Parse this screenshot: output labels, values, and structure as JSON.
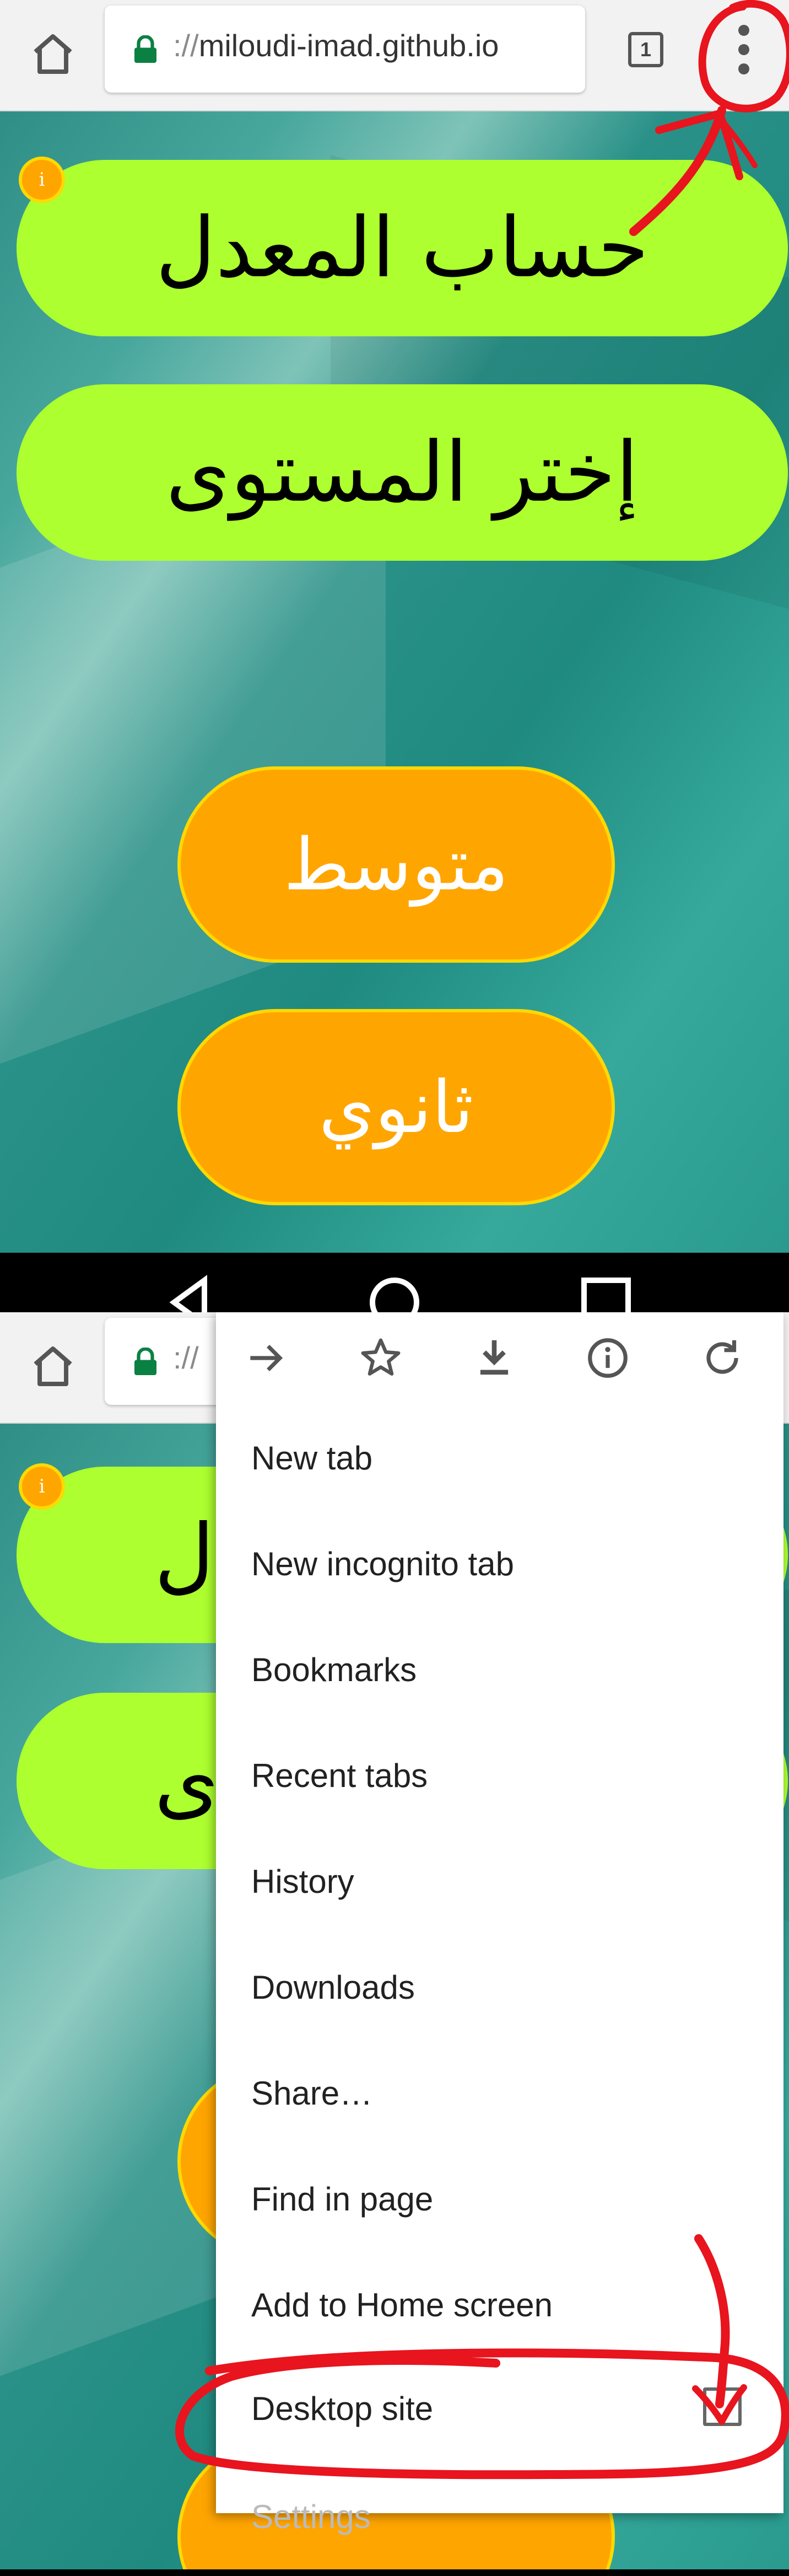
{
  "browser": {
    "url_scheme": "://",
    "url_host": "miloudi-imad.github.io",
    "tab_count": "1",
    "home_icon": "home-icon",
    "lock_icon": "lock-icon",
    "menu_icon": "more-vert-icon"
  },
  "page": {
    "title": "حساب المعدل",
    "subtitle": "إختر المستوى",
    "info_badge": "i",
    "levels": [
      "متوسط",
      "ثانوي"
    ],
    "title_partial": "ل",
    "subtitle_partial": "ى"
  },
  "menu": {
    "icons": [
      "forward-icon",
      "star-icon",
      "download-icon",
      "info-icon",
      "refresh-icon"
    ],
    "items": [
      "New tab",
      "New incognito tab",
      "Bookmarks",
      "Recent tabs",
      "History",
      "Downloads",
      "Share…",
      "Find in page",
      "Add to Home screen",
      "Desktop site"
    ],
    "desktop_site_checked": false,
    "next_item_partial": "Settings"
  },
  "colors": {
    "pill_green": "#adff2f",
    "pill_orange": "#ffa500",
    "annotation_red": "#e8141e",
    "lock_green": "#0b8043"
  }
}
